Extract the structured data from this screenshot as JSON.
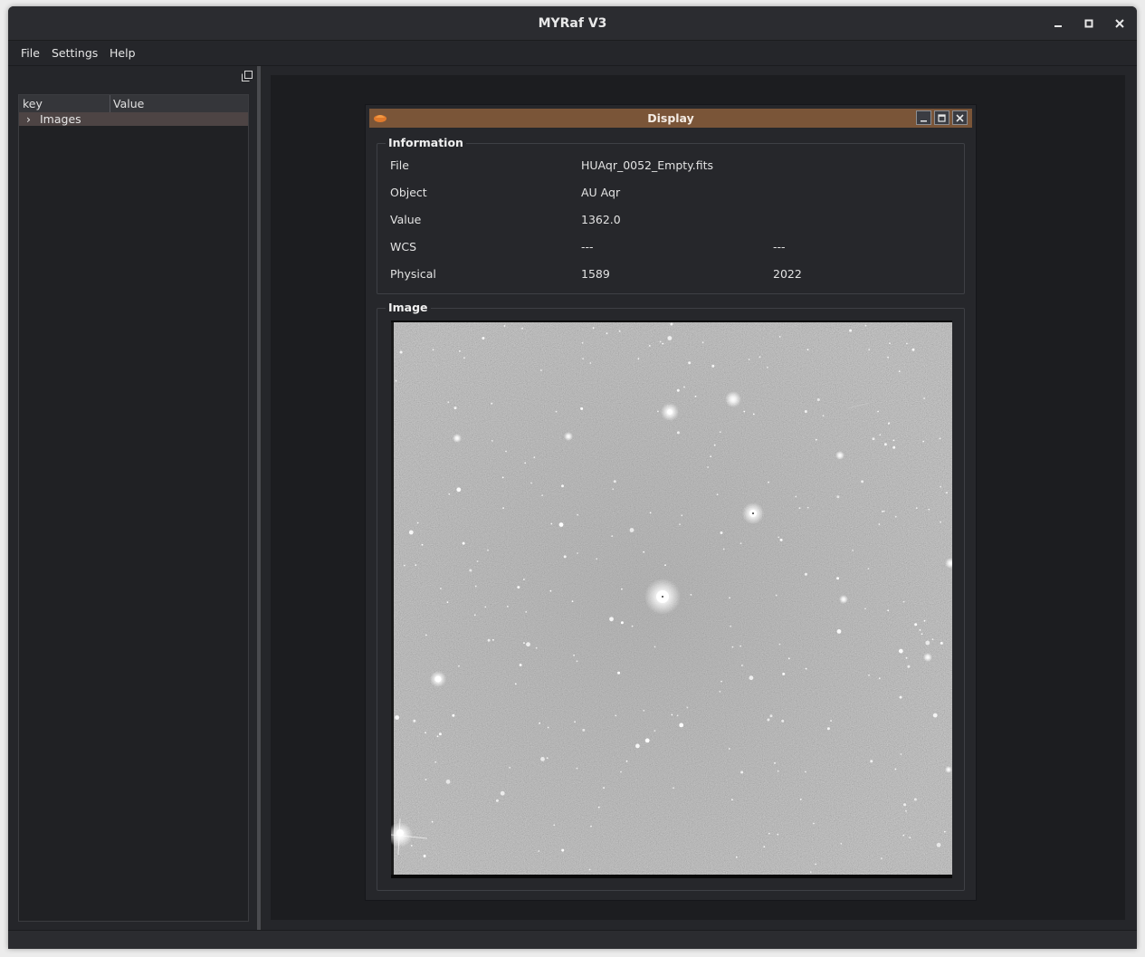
{
  "window": {
    "title": "MYRaf V3"
  },
  "titlebar_buttons": {
    "minimize": "minimize-icon",
    "maximize": "maximize-icon",
    "close": "close-icon"
  },
  "menu": [
    "File",
    "Settings",
    "Help"
  ],
  "tree": {
    "columns": [
      "key",
      "Value"
    ],
    "items": [
      {
        "expander": "›",
        "label": "Images"
      }
    ]
  },
  "display": {
    "title": "Display",
    "info_group": "Information",
    "image_group": "Image",
    "rows": [
      {
        "label": "File",
        "value1": "HUAqr_0052_Empty.fits",
        "value2": ""
      },
      {
        "label": "Object",
        "value1": "AU Aqr",
        "value2": ""
      },
      {
        "label": "Value",
        "value1": "1362.0",
        "value2": ""
      },
      {
        "label": "WCS",
        "value1": "---",
        "value2": "---"
      },
      {
        "label": "Physical",
        "value1": "1589",
        "value2": "2022"
      }
    ]
  },
  "colors": {
    "window_bg": "#252629",
    "subwindow_title": "#7a5538",
    "tree_selected": "#4d4444"
  }
}
